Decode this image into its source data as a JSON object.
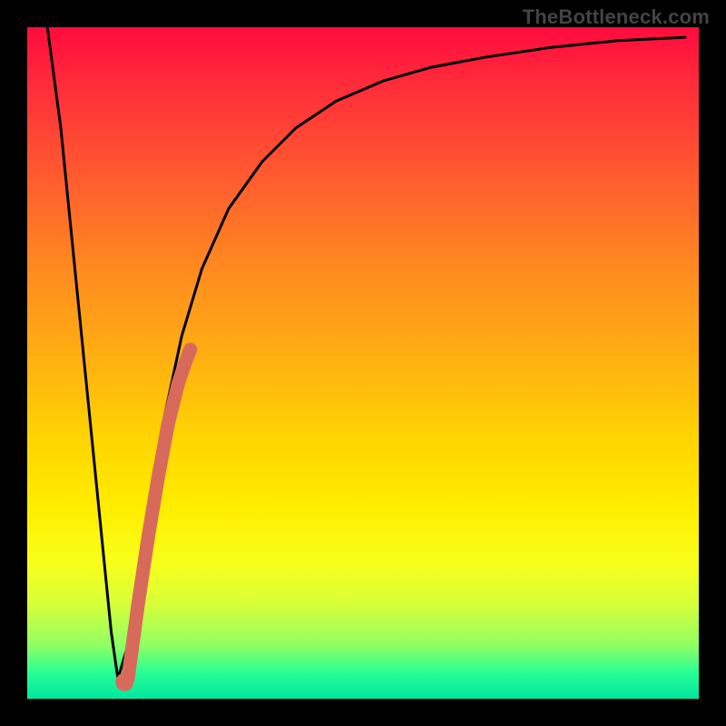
{
  "watermark": "TheBottleneck.com",
  "chart_data": {
    "type": "line",
    "title": "",
    "xlabel": "",
    "ylabel": "",
    "xlim": [
      0,
      100
    ],
    "ylim": [
      0,
      100
    ],
    "grid": false,
    "legend": false,
    "series": [
      {
        "name": "bottleneck-curve",
        "color": "#000000",
        "x": [
          3,
          5,
          7,
          9,
          11,
          12.5,
          13.5,
          15,
          17,
          20,
          23,
          26,
          30,
          35,
          40,
          46,
          53,
          60,
          68,
          78,
          88,
          98
        ],
        "y": [
          100,
          85,
          65,
          45,
          25,
          10,
          3,
          8,
          22,
          40,
          54,
          64,
          73,
          80,
          85,
          89,
          92,
          94,
          95.5,
          97,
          98,
          98.5
        ]
      },
      {
        "name": "highlight-segment",
        "color": "#d86a5c",
        "x": [
          14.5,
          15.0,
          16.5,
          18.0,
          19.5,
          21.0,
          22.5,
          23.5,
          24.3
        ],
        "y": [
          2.5,
          3.0,
          14,
          24,
          33,
          41,
          47,
          50,
          52
        ]
      }
    ],
    "gradient_background": {
      "orientation": "vertical",
      "stops": [
        {
          "pos": 0.0,
          "color": "#ff0b3e"
        },
        {
          "pos": 0.22,
          "color": "#ff5a2f"
        },
        {
          "pos": 0.5,
          "color": "#ffb211"
        },
        {
          "pos": 0.72,
          "color": "#ffee00"
        },
        {
          "pos": 0.92,
          "color": "#90ff63"
        },
        {
          "pos": 1.0,
          "color": "#00e6a0"
        }
      ]
    }
  }
}
